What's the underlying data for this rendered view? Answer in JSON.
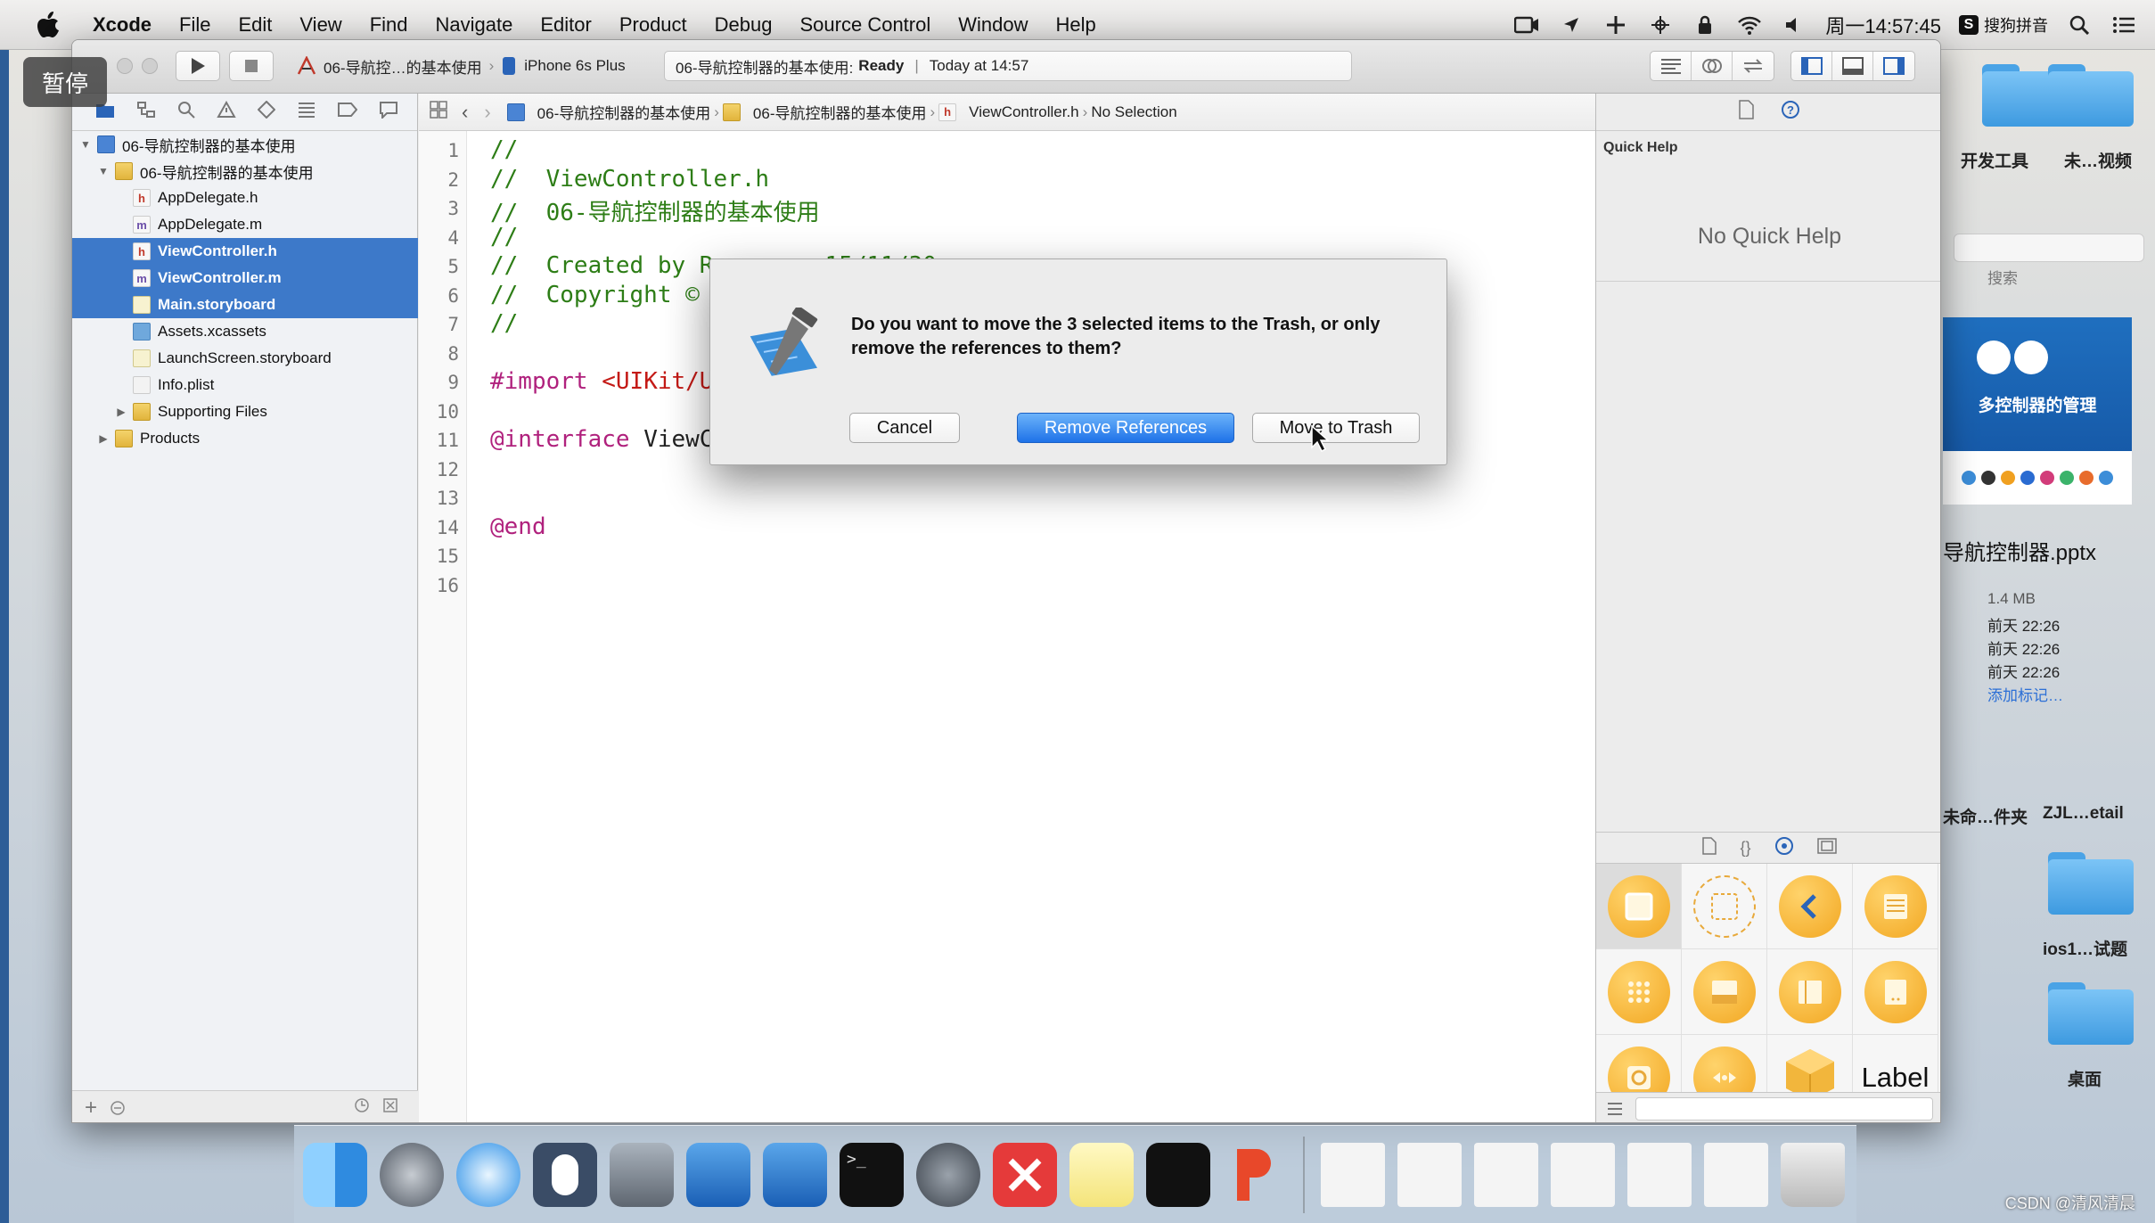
{
  "menubar": {
    "app": "Xcode",
    "items": [
      "File",
      "Edit",
      "View",
      "Find",
      "Navigate",
      "Editor",
      "Product",
      "Debug",
      "Source Control",
      "Window",
      "Help"
    ],
    "clock": "周一14:57:45",
    "input_method": "搜狗拼音"
  },
  "overlay": {
    "pause": "暂停",
    "watermark": "CSDN @清风清晨"
  },
  "toolbar": {
    "scheme": "06-导航控…的基本使用",
    "device": "iPhone 6s Plus",
    "activity_project": "06-导航控制器的基本使用:",
    "activity_status": "Ready",
    "activity_sep": "|",
    "activity_time": "Today at 14:57"
  },
  "navigator": {
    "rows": [
      {
        "label": "06-导航控制器的基本使用",
        "icon": "project-icon",
        "disclosure": "▼"
      },
      {
        "label": "06-导航控制器的基本使用",
        "icon": "folder-icon",
        "disclosure": "▼"
      },
      {
        "label": "AppDelegate.h",
        "icon": "h-file-icon",
        "badge": "h"
      },
      {
        "label": "AppDelegate.m",
        "icon": "m-file-icon",
        "badge": "m"
      },
      {
        "label": "ViewController.h",
        "icon": "h-file-icon",
        "badge": "h",
        "selected": true
      },
      {
        "label": "ViewController.m",
        "icon": "m-file-icon",
        "badge": "m",
        "selected": true
      },
      {
        "label": "Main.storyboard",
        "icon": "storyboard-icon",
        "selected": true
      },
      {
        "label": "Assets.xcassets",
        "icon": "assets-icon"
      },
      {
        "label": "LaunchScreen.storyboard",
        "icon": "storyboard-icon"
      },
      {
        "label": "Info.plist",
        "icon": "plist-icon"
      },
      {
        "label": "Supporting Files",
        "icon": "folder-icon",
        "disclosure": "▶"
      },
      {
        "label": "Products",
        "icon": "folder-icon",
        "disclosure": "▶"
      }
    ]
  },
  "jumpbar": {
    "crumbs": [
      "06-导航控制器的基本使用",
      "06-导航控制器的基本使用",
      "ViewController.h",
      "No Selection"
    ]
  },
  "editor": {
    "line_numbers": [
      "1",
      "2",
      "3",
      "4",
      "5",
      "6",
      "7",
      "8",
      "9",
      "10",
      "11",
      "12",
      "13",
      "14",
      "15",
      "16"
    ],
    "lines": [
      {
        "n": 1,
        "parts": [
          {
            "t": "//",
            "c": "cmt"
          }
        ]
      },
      {
        "n": 2,
        "parts": [
          {
            "t": "//  ViewController.h",
            "c": "cmt"
          }
        ]
      },
      {
        "n": 3,
        "parts": [
          {
            "t": "//  06-导航控制器的基本使用",
            "c": "cmt"
          }
        ]
      },
      {
        "n": 4,
        "parts": [
          {
            "t": "//",
            "c": "cmt"
          }
        ]
      },
      {
        "n": 5,
        "parts": [
          {
            "t": "//  Created by Romeo on 15/11/30.",
            "c": "cmt"
          }
        ]
      },
      {
        "n": 6,
        "parts": [
          {
            "t": "//  Copyright ©",
            "c": "cmt"
          }
        ]
      },
      {
        "n": 7,
        "parts": [
          {
            "t": "//",
            "c": "cmt"
          }
        ]
      },
      {
        "n": 8,
        "parts": []
      },
      {
        "n": 9,
        "parts": [
          {
            "t": "#import ",
            "c": "kw"
          },
          {
            "t": "<UIKit/U",
            "c": "str"
          }
        ]
      },
      {
        "n": 10,
        "parts": []
      },
      {
        "n": 11,
        "parts": [
          {
            "t": "@interface ",
            "c": "kw"
          },
          {
            "t": "ViewC",
            "c": "pl"
          }
        ]
      },
      {
        "n": 12,
        "parts": []
      },
      {
        "n": 13,
        "parts": []
      },
      {
        "n": 14,
        "parts": [
          {
            "t": "@end",
            "c": "kw"
          }
        ]
      },
      {
        "n": 15,
        "parts": []
      },
      {
        "n": 16,
        "parts": []
      }
    ]
  },
  "inspector": {
    "title": "Quick Help",
    "empty": "No Quick Help",
    "library_label_item": "Label"
  },
  "dialog": {
    "message": "Do you want to move the 3 selected items to the Trash, or only remove the references to them?",
    "cancel": "Cancel",
    "remove": "Remove References",
    "trash": "Move to Trash"
  },
  "desktop": {
    "items": [
      "开发工具",
      "未…视频",
      "搜索",
      "多控制器的管理",
      "导航控制器.pptx",
      "1.4 MB",
      "前天 22:26",
      "前天 22:26",
      "前天 22:26",
      "添加标记…",
      "未命…件夹",
      "ZJL…etail",
      "ios1…试题",
      "桌面"
    ]
  }
}
